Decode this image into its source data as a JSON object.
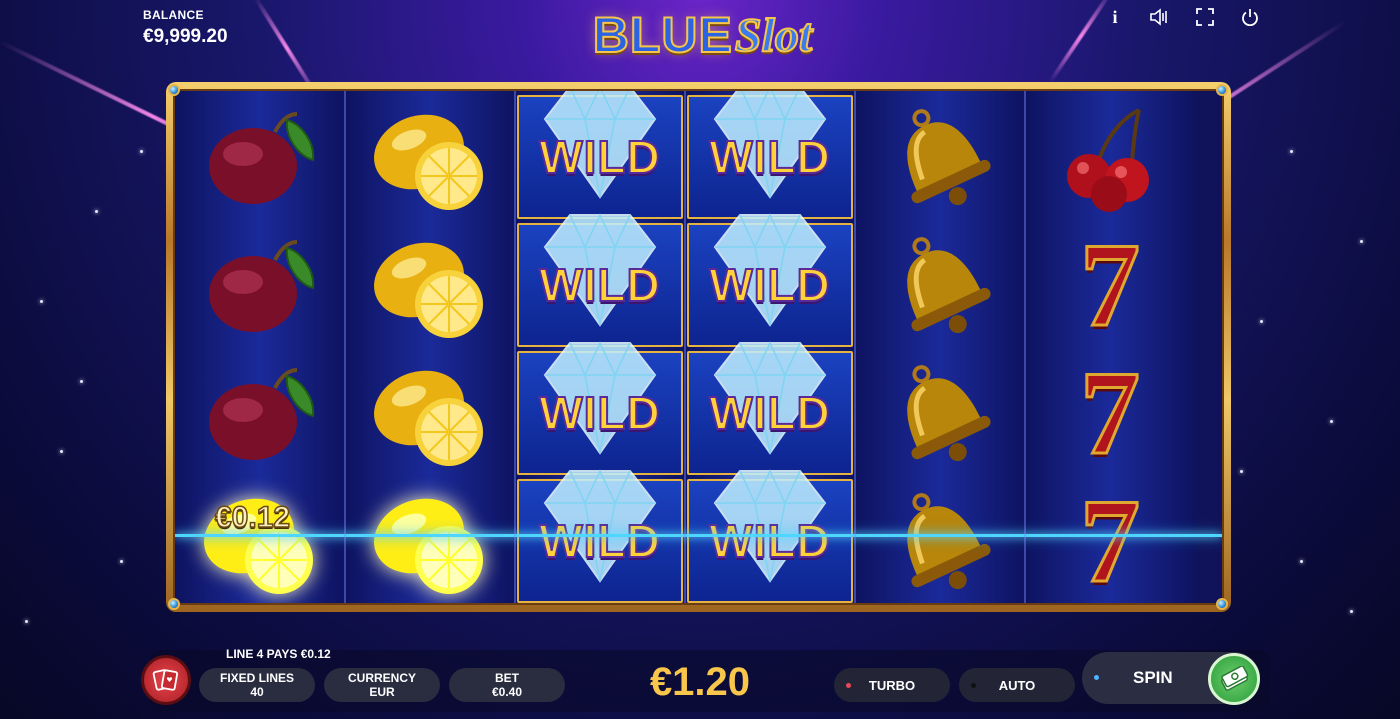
{
  "balance": {
    "label": "BALANCE",
    "value": "€9,999.20"
  },
  "logo": {
    "word1": "BLUE",
    "word2": "Slot"
  },
  "top_icons": [
    "info-icon",
    "sound-icon",
    "fullscreen-icon",
    "power-icon"
  ],
  "top_icon_glyphs": {
    "info": "i",
    "sound": "◁)",
    "fullscreen": "⛶",
    "power": "⏻"
  },
  "reels": [
    [
      "plum",
      "plum",
      "plum",
      "lemon"
    ],
    [
      "lemon",
      "lemon",
      "lemon",
      "lemon"
    ],
    [
      "wild",
      "wild",
      "wild",
      "wild"
    ],
    [
      "wild",
      "wild",
      "wild",
      "wild"
    ],
    [
      "bell",
      "bell",
      "bell",
      "bell"
    ],
    [
      "cherry",
      "seven",
      "seven",
      "seven"
    ]
  ],
  "symbols": {
    "wild_text": "WILD",
    "seven_text": "7"
  },
  "win": {
    "amount_label": "€0.12",
    "line_message": "LINE 4 PAYS €0.12"
  },
  "controls": {
    "fixed_lines_label": "FIXED LINES",
    "fixed_lines_value": "40",
    "currency_label": "CURRENCY",
    "currency_value": "EUR",
    "bet_label": "BET",
    "bet_value": "€0.40",
    "total_win": "€1.20",
    "turbo_label": "TURBO",
    "auto_label": "AUTO",
    "spin_label": "SPIN"
  },
  "colors": {
    "accent_gold": "#f7c64a",
    "payline": "#4fd6ff",
    "turbo_dot": "#e84a55",
    "auto_dot": "#1a1a1a",
    "spin_dot": "#4fb3ff"
  }
}
